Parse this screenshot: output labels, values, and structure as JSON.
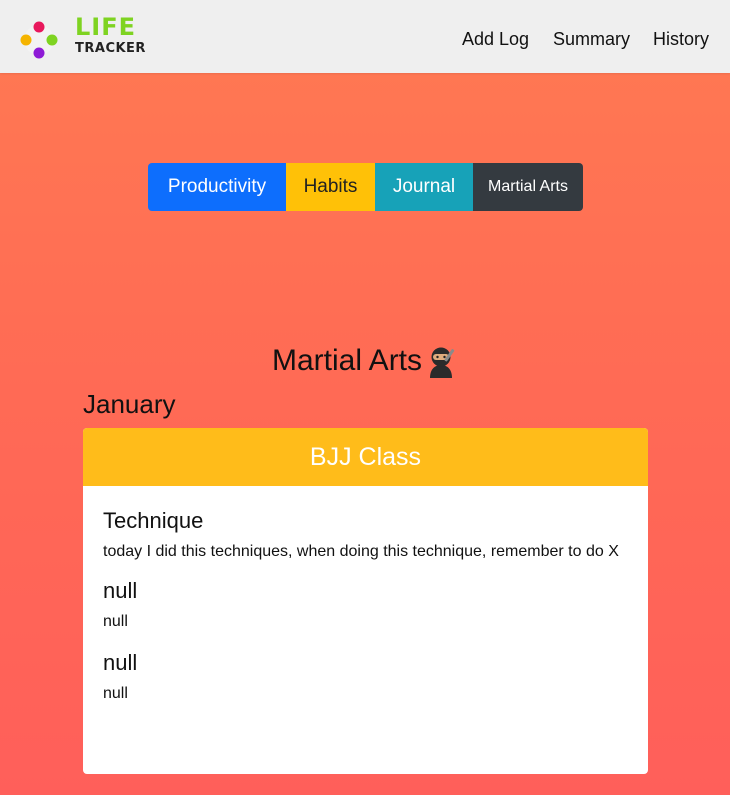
{
  "nav": {
    "logo_top": "LIFE",
    "logo_bottom": "TRACKER",
    "links": [
      "Add Log",
      "Summary",
      "History"
    ]
  },
  "categories": [
    "Productivity",
    "Habits",
    "Journal",
    "Martial Arts"
  ],
  "page": {
    "title": "Martial Arts",
    "month": "January"
  },
  "card": {
    "header": "BJJ Class",
    "entries": [
      {
        "title": "Technique",
        "text": "today I did this techniques, when doing this technique, remember to do X"
      },
      {
        "title": "null",
        "text": "null"
      },
      {
        "title": "null",
        "text": "null"
      }
    ]
  },
  "colors": {
    "nav_bg": "#efefef",
    "logo_green": "#7ed321",
    "primary": "#0d6efd",
    "warning": "#ffc107",
    "info": "#17a2b8",
    "dark": "#343a40",
    "card_header": "#ffbc1a",
    "bg_gradient_top": "#ff7a52",
    "bg_gradient_bottom": "#ff5f5a"
  },
  "icons": {
    "logo": "four-colored-dots-logo",
    "title_emoji": "ninja-icon"
  }
}
